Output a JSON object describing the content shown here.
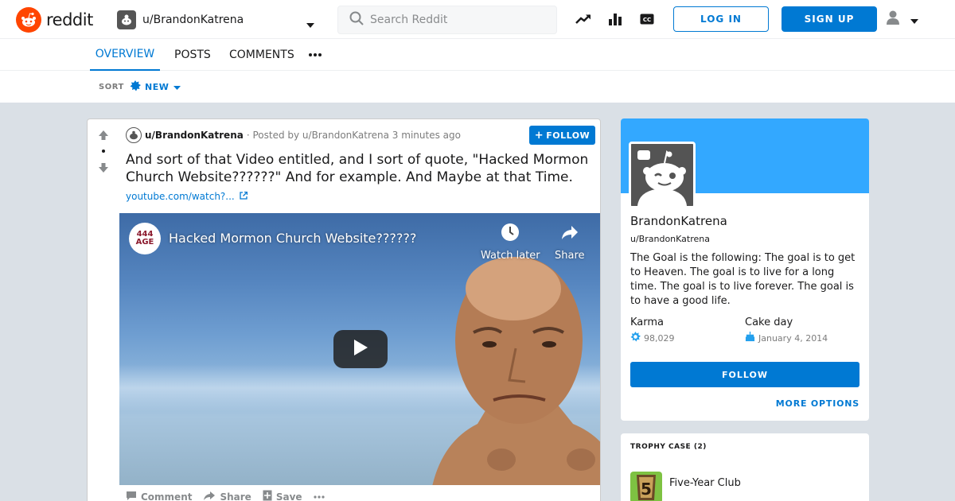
{
  "header": {
    "logo_text": "reddit",
    "user_dropdown_label": "u/BrandonKatrena",
    "search_placeholder": "Search Reddit",
    "login_label": "LOG IN",
    "signup_label": "SIGN UP"
  },
  "tabs": [
    {
      "label": "OVERVIEW",
      "active": true
    },
    {
      "label": "POSTS",
      "active": false
    },
    {
      "label": "COMMENTS",
      "active": false
    }
  ],
  "sort": {
    "label": "SORT",
    "value": "NEW"
  },
  "post": {
    "author": "u/BrandonKatrena",
    "posted_by": "· Posted by u/BrandonKatrena 3 minutes ago",
    "follow_label": "FOLLOW",
    "title": "And sort of that Video entitled, and I sort of quote, \"Hacked Mormon Church Website??????\" And for example. And Maybe at that Time.",
    "link_text": "youtube.com/watch?...",
    "video": {
      "channel_badge_line1": "444",
      "channel_badge_line2": "AGE",
      "title": "Hacked Mormon Church Website??????",
      "watch_later_label": "Watch later",
      "share_label": "Share"
    },
    "actions": {
      "comment": "Comment",
      "share": "Share",
      "save": "Save"
    }
  },
  "profile": {
    "display_name": "BrandonKatrena",
    "username": "u/BrandonKatrena",
    "description": "The Goal is the following: The goal is to get to Heaven. The goal is to live for a long time. The goal is to live forever. The goal is to have a good life.",
    "karma_label": "Karma",
    "karma_value": "98,029",
    "cake_label": "Cake day",
    "cake_value": "January 4, 2014",
    "follow_label": "FOLLOW",
    "more_options_label": "MORE OPTIONS"
  },
  "trophy_case": {
    "title": "TROPHY CASE (2)",
    "items": [
      {
        "name": "Five-Year Club",
        "badge": "5"
      }
    ]
  },
  "colors": {
    "brand": "#ff4500",
    "accent": "#0079d3",
    "banner": "#33a8ff",
    "background": "#dae0e6"
  }
}
